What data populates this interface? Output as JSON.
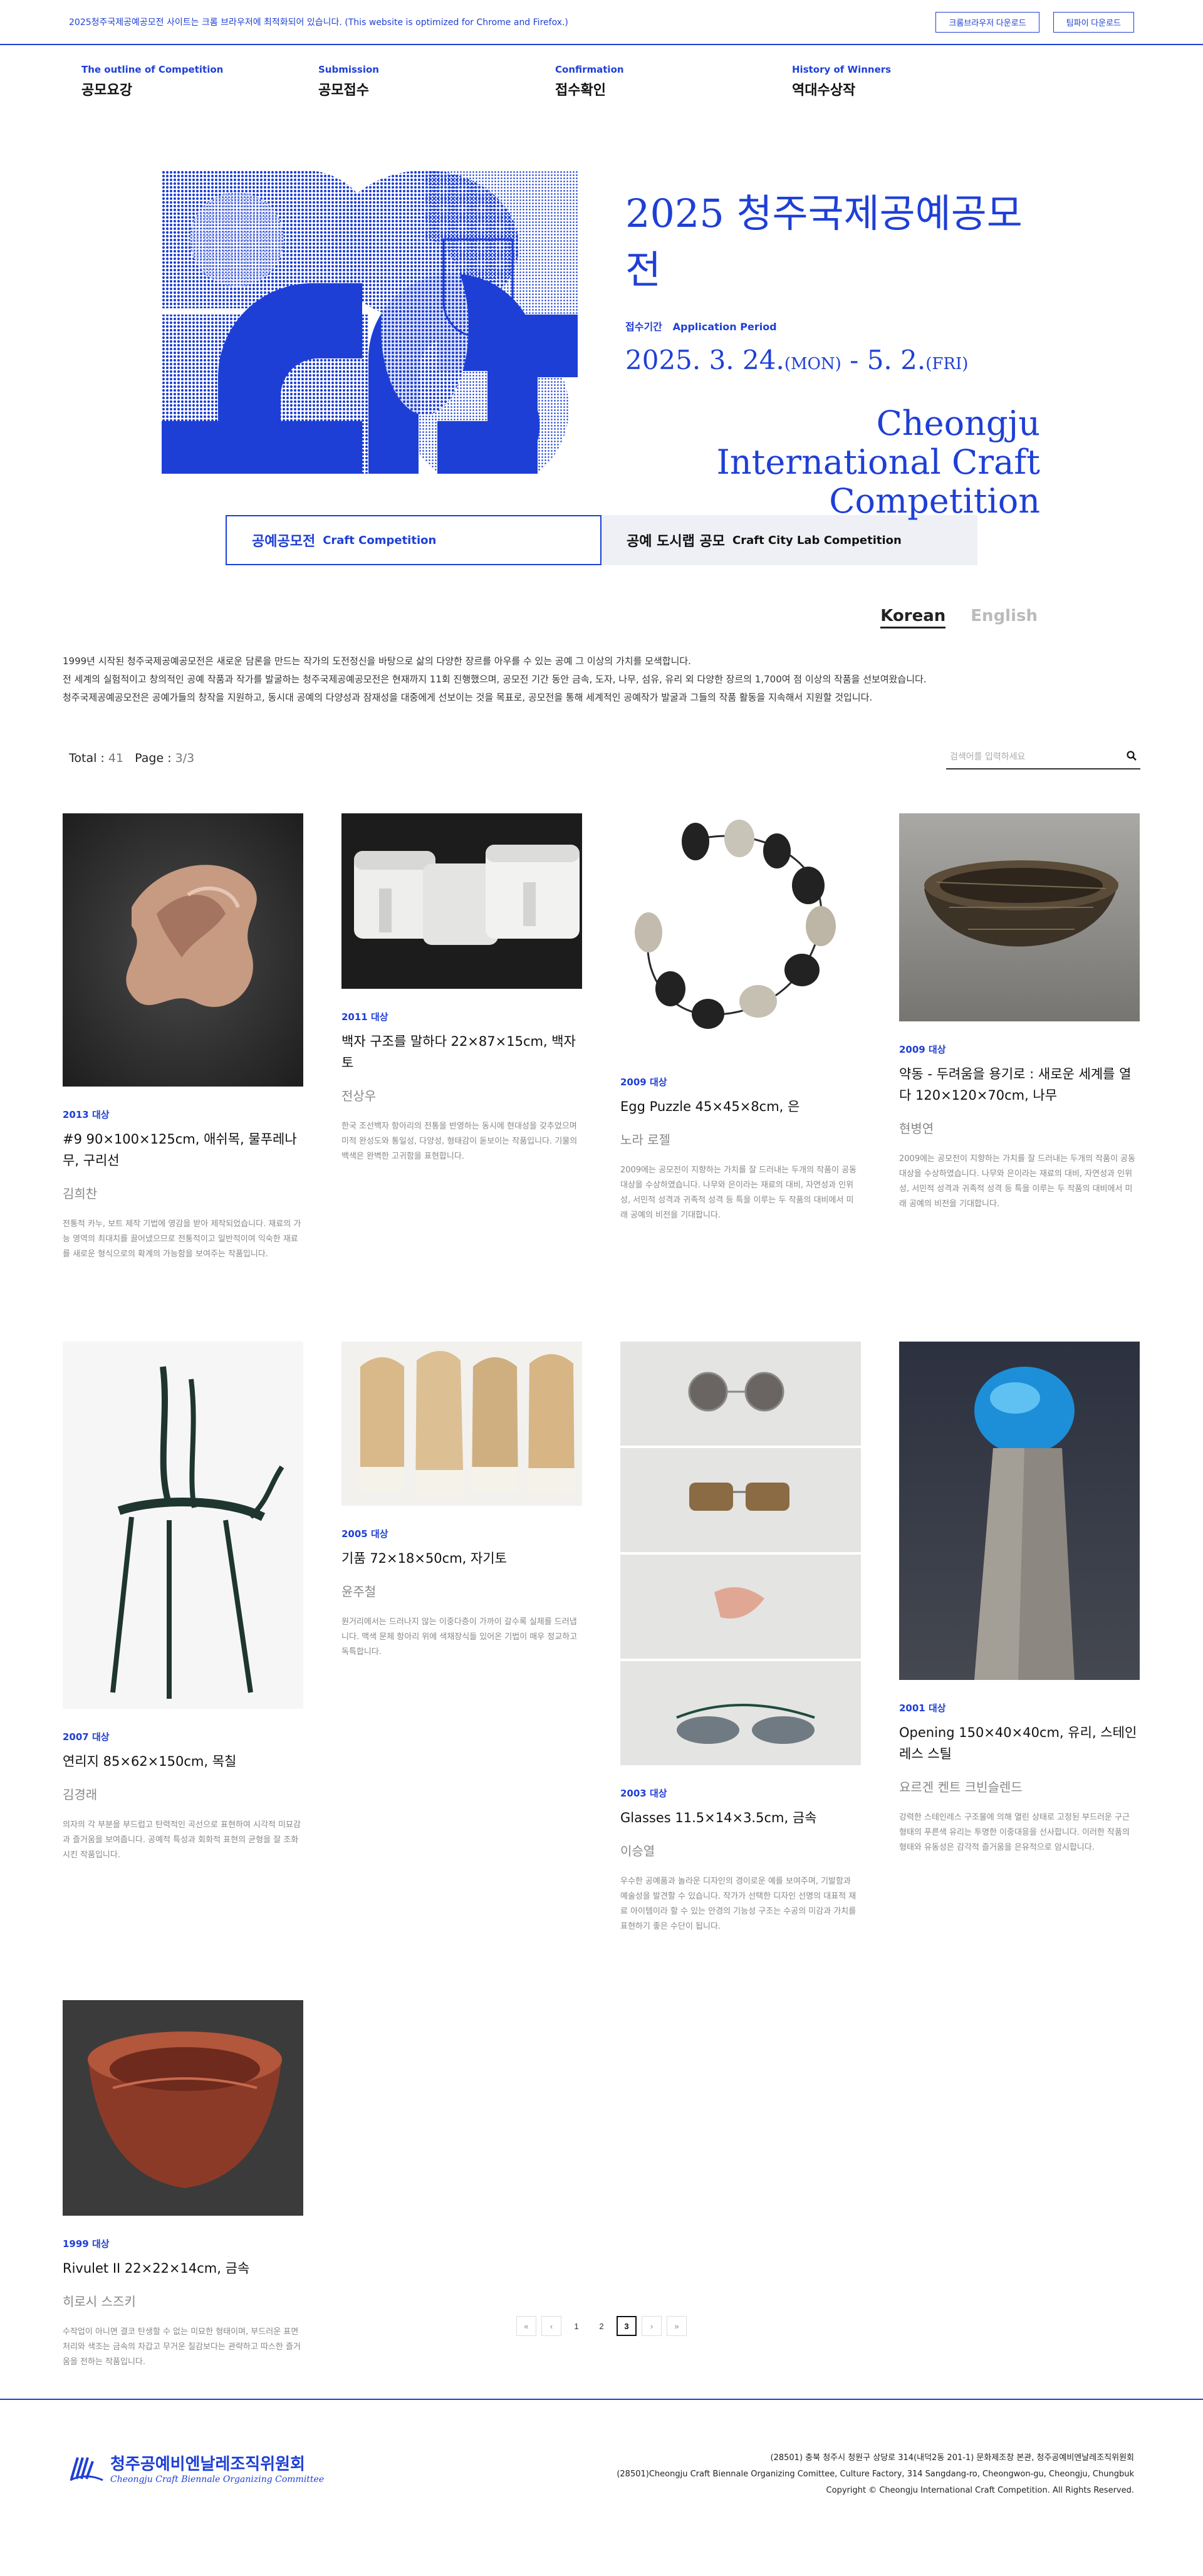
{
  "topbar": {
    "notice": "2025청주국제공예공모전 사이트는 크롬 브라우저에 최적화되어 있습니다. (This website is optimized for Chrome and Firefox.)",
    "chrome_button": "크롬브라우저 다운로드",
    "firefox_button": "팀파이 다운로드"
  },
  "nav": [
    {
      "en": "The outline of Competition",
      "ko": "공모요강"
    },
    {
      "en": "Submission",
      "ko": "공모접수"
    },
    {
      "en": "Confirmation",
      "ko": "접수확인"
    },
    {
      "en": "History of Winners",
      "ko": "역대수상작"
    }
  ],
  "hero": {
    "title": "2025 청주국제공예공모전",
    "period_label_ko": "접수기간",
    "period_label_en": "Application Period",
    "date_start": "2025. 3. 24.",
    "dow_start": "(MON)",
    "date_sep": " - ",
    "date_end": "5. 2.",
    "dow_end": "(FRI)",
    "name_en_1": "Cheongju",
    "name_en_2": "International Craft",
    "name_en_3": "Competition",
    "accent": "#1e3fd6"
  },
  "competition_tabs": [
    {
      "ko": "공예공모전",
      "en": "Craft Competition",
      "active": true
    },
    {
      "ko": "공예 도시랩 공모",
      "en": "Craft City Lab Competition",
      "active": false
    }
  ],
  "language": {
    "korean": "Korean",
    "english": "English"
  },
  "intro": [
    "1999년 시작된 청주국제공예공모전은 새로운 담론을 만드는 작가의 도전정신을 바탕으로 삶의 다양한 장르를 아우를 수 있는 공예 그 이상의 가치를 모색합니다.",
    "전 세계의 실험적이고 창의적인 공예 작품과 작가를 발굴하는 청주국제공예공모전은 현재까지 11회 진행했으며, 공모전 기간 동안 금속, 도자, 나무, 섬유, 유리 외 다양한 장르의 1,700여 점 이상의 작품을 선보여왔습니다.",
    "청주국제공예공모전은 공예가들의 창작을 지원하고, 동시대 공예의 다양성과 잠재성을 대중에게 선보이는 것을 목표로, 공모전을 통해 세계적인 공예작가 발굴과 그들의 작품 활동을 지속해서 지원할 것입니다."
  ],
  "toolbar": {
    "total_label": "Total : ",
    "total": "41",
    "page_label": "Page : ",
    "page": "3/3",
    "search_placeholder": "검색어를 입력하세요"
  },
  "works": [
    {
      "year": "2013 대상",
      "title": "#9 90×100×125cm, 애쉬목, 물푸레나무, 구리선",
      "artist": "김희찬",
      "desc": "전통적 카누, 보트 제작 기법에 영감을 받아 제작되었습니다. 재료의 가능 영역의 최대치를 끌어냈으므로 전통적이고 일반적이여 익숙한 재료를 새로운 형식으로의 확계의 가능함을 보여주는 작품입니다."
    },
    {
      "year": "2011 대상",
      "title": "백자 구조를 말하다 22×87×15cm, 백자토",
      "artist": "전상우",
      "desc": "한국 조선백자 항아리의 전통을 반영하는 동시에 현대성을 갖추었으며 미적 완성도와 통일성, 다양성, 형태감이 돋보이는 작품입니다. 기물의 백색은 완벽한 고귀함을 표현합니다."
    },
    {
      "year": "2009 대상",
      "title": "Egg Puzzle 45×45×8cm, 은",
      "artist": "노라 로젤",
      "desc": "2009에는 공모전이 지향하는 가치를 잘 드러내는 두개의 작품이 공동 대상을 수상하였습니다. 나무와 은이라는 재료의 대비, 자연성과 인위성, 서민적 성격과 귀족적 성격 등 특을 이루는 두 작품의 대비에서 미래 공예의 비전을 기대합니다."
    },
    {
      "year": "2009 대상",
      "title": "약동 - 두려움을 용기로 : 새로운 세계를 열다 120×120×70cm, 나무",
      "artist": "현병연",
      "desc": "2009에는 공모전이 지향하는 가치를 잘 드러내는 두개의 작품이 공동 대상을 수상하였습니다. 나무와 은이라는 재료의 대비, 자연성과 인위성, 서민적 성격과 귀족적 성격 등 특을 이루는 두 작품의 대비에서 미래 공예의 비전을 기대합니다."
    },
    {
      "year": "2007 대상",
      "title": "연리지 85×62×150cm, 목칠",
      "artist": "김경래",
      "desc": "의자의 각 부분을 부드럽고 탄력적인 곡선으로 표현하여 시각적 미묘감과 즐거움을 보여줍니다. 공예적 특성과 회화적 표현의 균형을 잘 조화시킨 작품입니다."
    },
    {
      "year": "2005 대상",
      "title": "기품 72×18×50cm, 자기토",
      "artist": "윤주철",
      "desc": "원거리에서는 드러나지 않는 이중다층이 가까이 갈수록 실체를 드러냅니다. 맥색 문체 항아리 위에 색채장식들 있어온 기법이 매우 정교하고 독특합니다."
    },
    {
      "year": "2003 대상",
      "title": "Glasses 11.5×14×3.5cm, 금속",
      "artist": "이승열",
      "desc": "우수한 공예품과 놀라운 디자인의 경이로운 예를 보여주며, 기발함과 예술성을 발견할 수 있습니다. 작가가 선택한 디자인 선명의 대표적 재료 아이템이라 할 수 있는 안경의 기능성 구조는 수공의 미감과 가치를 표현하기 좋은 수단이 됩니다."
    },
    {
      "year": "2001 대상",
      "title": "Opening 150×40×40cm, 유리, 스테인레스 스틸",
      "artist": "요르겐 켄트 크빈슬렌드",
      "desc": "강력한 스테인레스 구조물에 의해 열린 상태로 고정된 부드러운 구근 형태의 푸른색 유리는 투명한 이중대응을 선사합니다. 이러한 작품의 형태와 유동성은 감각적 즐거움을 은유적으로 암시합니다."
    },
    {
      "year": "1999 대상",
      "title": "Rivulet II 22×22×14cm, 금속",
      "artist": "히로시 스즈키",
      "desc": "수작업이 아니면 결코 탄생할 수 없는 미묘한 형태이며, 부드러운 표면처리와 색조는 금속의 차갑고 무거운 질감보다는 관략하고 따스한 즐거움을 전하는 작품입니다."
    }
  ],
  "pager": {
    "first": "«",
    "prev": "‹",
    "p1": "1",
    "p2": "2",
    "p3": "3",
    "next": "›",
    "last": "»"
  },
  "footer": {
    "logo_ko": "청주공예비엔날레조직위원회",
    "logo_en": "Cheongju Craft Biennale Organizing Committee",
    "addr_ko": "(28501) 충북 청주시 청원구 상당로 314(내덕2동 201-1) 문화제조창 본관, 청주공예비엔날레조직위원회",
    "addr_en": "(28501)Cheongju Craft Biennale Organizing Comittee, Culture Factory, 314 Sangdang-ro, Cheongwon-gu, Cheongju, Chungbuk",
    "copyright": "Copyright © Cheongju International Craft Competition. All Rights Reserved."
  }
}
